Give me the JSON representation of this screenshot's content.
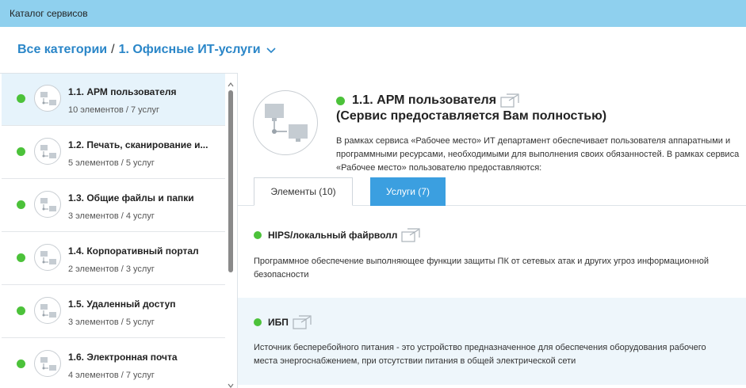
{
  "header": {
    "title": "Каталог сервисов"
  },
  "breadcrumb": {
    "root": "Все категории",
    "separator": "/",
    "current": "1. Офисные ИТ-услуги"
  },
  "sidebar": {
    "items": [
      {
        "name": "1.1. АРМ пользователя",
        "meta": "10 элементов / 7 услуг",
        "status_color": "#4cc23a"
      },
      {
        "name": "1.2. Печать, сканирование и...",
        "meta": "5 элементов / 5 услуг",
        "status_color": "#4cc23a"
      },
      {
        "name": "1.3. Общие файлы и папки",
        "meta": "3 элементов / 4 услуг",
        "status_color": "#4cc23a"
      },
      {
        "name": "1.4. Корпоративный портал",
        "meta": "2 элементов / 3 услуг",
        "status_color": "#4cc23a"
      },
      {
        "name": "1.5. Удаленный доступ",
        "meta": "3 элементов / 5 услуг",
        "status_color": "#4cc23a"
      },
      {
        "name": "1.6. Электронная почта",
        "meta": "4 элементов / 7 услуг",
        "status_color": "#4cc23a"
      }
    ]
  },
  "service": {
    "title": "1.1. АРМ пользователя",
    "subtitle": "(Сервис предоставляется Вам полностью)",
    "description": "В рамках сервиса «Рабочее место» ИТ департамент обеспечивает пользователя аппаратными и программными ресурсами, необходимыми для выполнения своих обязанностей. В рамках сервиса «Рабочее место» пользователю предоставляются:"
  },
  "tabs": {
    "elements": "Элементы (10)",
    "services": "Услуги (7)"
  },
  "cards": [
    {
      "title": "HIPS/локальный файрволл",
      "desc": "Программное обеспечение выполняющее функции защиты ПК от сетевых атак и других угроз информационной безопасности"
    },
    {
      "title": "ИБП",
      "desc": "Источник бесперебойного питания - это устройство предназначенное для обеспечения оборудования рабочего места энергоснабжением, при отсутствии питания в общей электрической сети"
    }
  ],
  "colors": {
    "accent": "#2a86c8",
    "topbar": "#8fd0ee",
    "status_ok": "#4cc23a",
    "active_tab": "#3b9fe0"
  },
  "icons": {
    "service": "network-computers-icon",
    "external": "open-external-icon",
    "dropdown": "chevron-down-icon"
  }
}
